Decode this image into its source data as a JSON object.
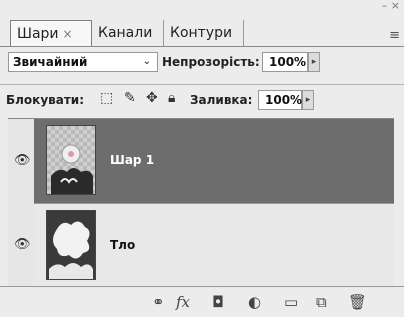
{
  "tabs": {
    "layers": "Шари",
    "layers_close": "×",
    "channels": "Канали",
    "paths": "Контури"
  },
  "window_controls": "– ×",
  "panel_menu_icon": "≡",
  "blend_mode": {
    "value": "Звичайний",
    "arrow": "⌄"
  },
  "opacity": {
    "label": "Непрозорість:",
    "value": "100%",
    "arrow": "▸"
  },
  "lock": {
    "label": "Блокувати:",
    "icons": [
      "lock-transparent-icon",
      "lock-paint-icon",
      "lock-move-icon",
      "lock-all-icon"
    ]
  },
  "fill": {
    "label": "Заливка:",
    "value": "100%",
    "arrow": "▸"
  },
  "layers": [
    {
      "name": "Шар 1",
      "selected": true,
      "visible": true
    },
    {
      "name": "Тло",
      "selected": false,
      "visible": true
    }
  ],
  "bottom_icons": [
    "link-layers-icon",
    "fx-icon",
    "add-mask-icon",
    "adjustment-layer-icon",
    "new-group-icon",
    "new-layer-icon",
    "trash-icon"
  ],
  "bottom_glyphs": {
    "link": "⚭",
    "fx": "fx",
    "mask": "◘",
    "adjust": "◐",
    "group": "▭",
    "new": "⧉",
    "trash": "🗑"
  },
  "colors": {
    "selected_row": "#6d6d6d",
    "panel_bg": "#ececec"
  }
}
